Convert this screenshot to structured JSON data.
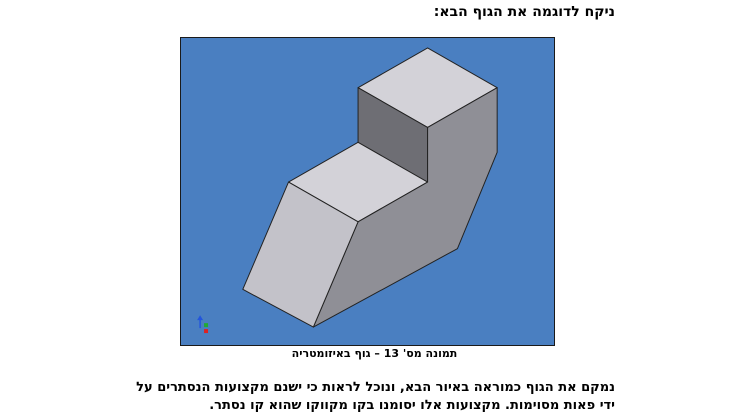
{
  "heading": "ניקח לדוגמה את הגוף הבא:",
  "figure": {
    "background_color": "#4a7fc1",
    "face_colors": {
      "top": "#d3d2d8",
      "front_left": "#c3c2c9",
      "front_right": "#8f8f96",
      "inner_step": "#6e6e74"
    },
    "axis_triad_icon": "xyz-axis-triad-icon"
  },
  "caption": "תמונה מס' 13 – גוף באיזומטריה",
  "paragraph": {
    "line1": "נמקם את הגוף כמוראה באיור הבא, ונוכל לראות כי ישנם מקצועות הנסתרים על",
    "line2": "ידי פאות מסוימות. מקצועות אלו יסומנו בקו מקווקו שהוא קו נסתר."
  }
}
